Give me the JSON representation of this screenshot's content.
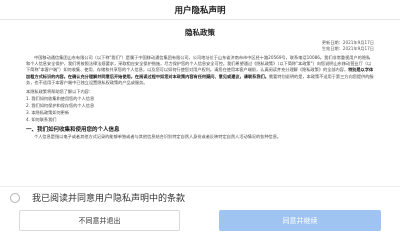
{
  "header": {
    "title": "用户隐私声明"
  },
  "document": {
    "title": "隐私政策",
    "update_date": "更新日期：2021年9月17日",
    "effective_date": "生效日期：2021年9月17日",
    "intro_before_bold": "中国移动通信集团山东有限公司（以下称\"我们\"）是属于中国移动通信集团有限公司，公司地址位于山东省济南市市中区经十路20569号，联系电话10086。我们非常重视用户的隐私和个人信息安全保护，我们将按照法律法规要求，采取相应安全保护措施，尽力保护您的个人信息安全可控。我们希望通过《隐私政策》（以下简称\"本政策\"）向您说明山东移动营业厅（以下简称\"本客户端\"）如何收集、使用、存储和共享您的个人信息，以及您可以如何行使您对用户权利。请您在使用本客户端前，认真阅读并充分理解《隐私政策》的全部内容，",
    "intro_bold": "特别是以字体加粗方式标识的内容。在确认充分理解并同意后开始使用。在阅读过程中如您对本政策内容有任何疑问、意见或建议，请联系我们。",
    "intro_after_bold": "需要特别说明的是，本政策不适用于第三方向您提供的服务，也不适用于本客户端中已独立设置隐私权政策的产品或服务。",
    "list_intro": "本隐私政策将帮助您了解以下内容：",
    "items": [
      "1. 我们如何收集和使用您的个人信息",
      "2. 我们如何保护和保存您的个人信息",
      "3. 本隐私政策如何更新",
      "4. 如何联系我们"
    ],
    "section_title": "一、我们如何收集和使用您的个人信息",
    "section_para": "个人信息是指以电子或者其他方式记录的能够单独或者与其他信息结合识别特定自然人身份或者反映特定自然人活动情况的各种信息。"
  },
  "consent": {
    "label": "我已阅读并同意用户隐私声明中的条款",
    "checked": false
  },
  "buttons": {
    "decline": "不同意并退出",
    "agree": "同意并继续"
  },
  "colors": {
    "agree_bg": "#9fc4f2",
    "agree_text": "#ffffff"
  }
}
